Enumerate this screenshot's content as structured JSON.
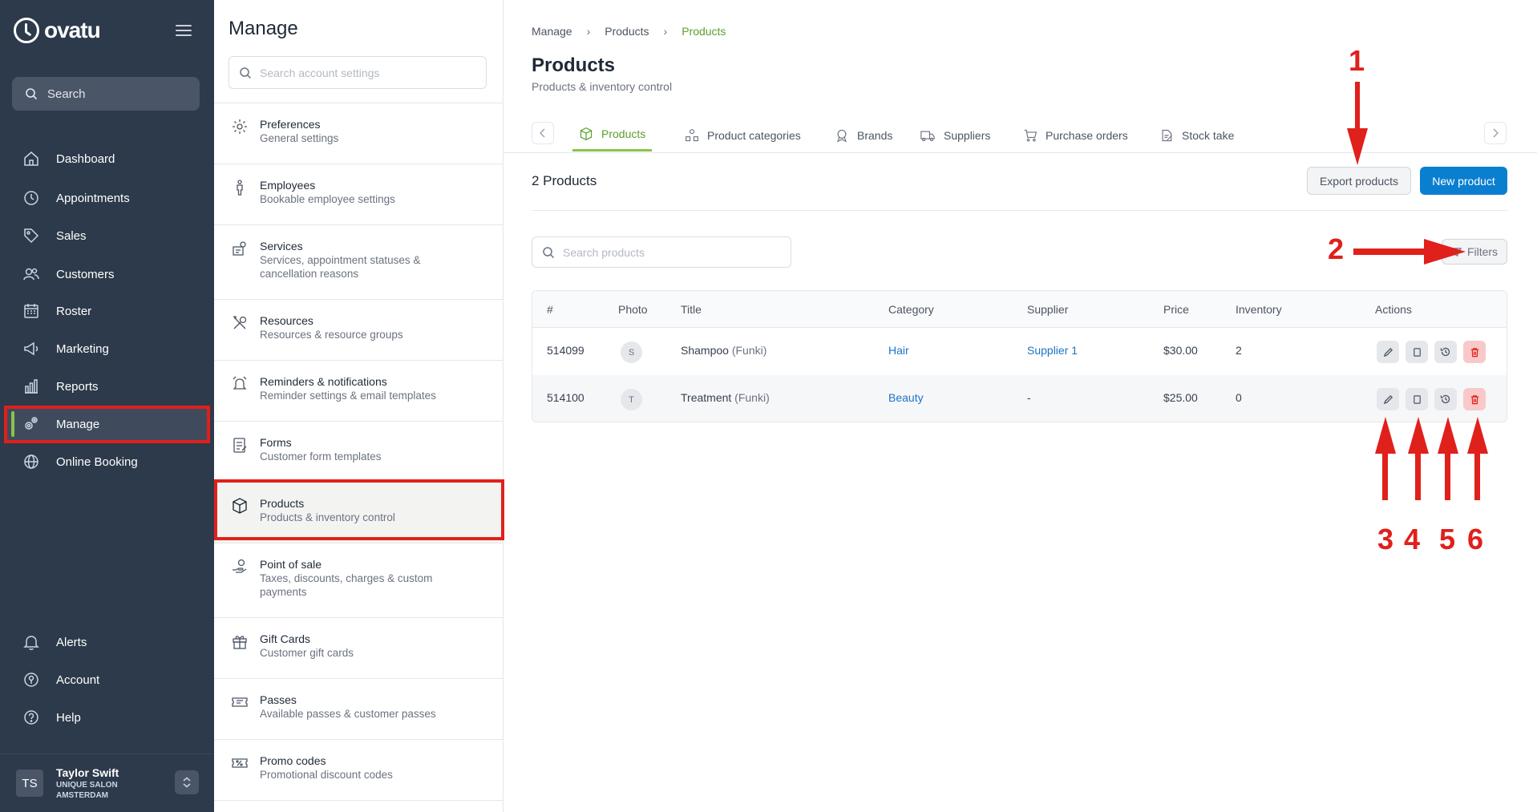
{
  "sidebar": {
    "brand": "ovatu",
    "search_label": "Search",
    "nav": [
      {
        "label": "Dashboard",
        "icon": "home-icon"
      },
      {
        "label": "Appointments",
        "icon": "clock-icon"
      },
      {
        "label": "Sales",
        "icon": "tag-icon"
      },
      {
        "label": "Customers",
        "icon": "users-icon"
      },
      {
        "label": "Roster",
        "icon": "calendar-icon"
      },
      {
        "label": "Marketing",
        "icon": "megaphone-icon"
      },
      {
        "label": "Reports",
        "icon": "bar-chart-icon"
      },
      {
        "label": "Manage",
        "icon": "gears-icon"
      },
      {
        "label": "Online Booking",
        "icon": "globe-icon"
      }
    ],
    "bottom_nav": [
      {
        "label": "Alerts",
        "icon": "bell-icon"
      },
      {
        "label": "Account",
        "icon": "account-icon"
      },
      {
        "label": "Help",
        "icon": "help-icon"
      }
    ],
    "user": {
      "initials": "TS",
      "name": "Taylor Swift",
      "line1": "UNIQUE SALON",
      "line2": "AMSTERDAM"
    }
  },
  "settings": {
    "title": "Manage",
    "search_placeholder": "Search account settings",
    "items": [
      {
        "title": "Preferences",
        "desc": "General settings"
      },
      {
        "title": "Employees",
        "desc": "Bookable employee settings"
      },
      {
        "title": "Services",
        "desc": "Services, appointment statuses & cancellation reasons"
      },
      {
        "title": "Resources",
        "desc": "Resources & resource groups"
      },
      {
        "title": "Reminders & notifications",
        "desc": "Reminder settings & email templates"
      },
      {
        "title": "Forms",
        "desc": "Customer form templates"
      },
      {
        "title": "Products",
        "desc": "Products & inventory control"
      },
      {
        "title": "Point of sale",
        "desc": "Taxes, discounts, charges & custom payments"
      },
      {
        "title": "Gift Cards",
        "desc": "Customer gift cards"
      },
      {
        "title": "Passes",
        "desc": "Available passes & customer passes"
      },
      {
        "title": "Promo codes",
        "desc": "Promotional discount codes"
      }
    ]
  },
  "main": {
    "breadcrumb": [
      "Manage",
      "Products",
      "Products"
    ],
    "title": "Products",
    "subtitle": "Products & inventory control",
    "tabs": [
      {
        "label": "Products",
        "icon": "box-icon"
      },
      {
        "label": "Product categories",
        "icon": "category-icon"
      },
      {
        "label": "Brands",
        "icon": "badge-icon"
      },
      {
        "label": "Suppliers",
        "icon": "truck-icon"
      },
      {
        "label": "Purchase orders",
        "icon": "cart-icon"
      },
      {
        "label": "Stock take",
        "icon": "clipboard-icon"
      }
    ],
    "count_title": "2 Products",
    "export_label": "Export products",
    "new_label": "New product",
    "search_placeholder": "Search products",
    "filters_label": "Filters",
    "table": {
      "headers": [
        "#",
        "Photo",
        "Title",
        "Category",
        "Supplier",
        "Price",
        "Inventory",
        "Actions"
      ],
      "rows": [
        {
          "id": "514099",
          "photo": "S",
          "title": "Shampoo",
          "brand": "(Funki)",
          "category": "Hair",
          "supplier": "Supplier 1",
          "price": "$30.00",
          "inventory": "2"
        },
        {
          "id": "514100",
          "photo": "T",
          "title": "Treatment",
          "brand": "(Funki)",
          "category": "Beauty",
          "supplier": "-",
          "price": "$25.00",
          "inventory": "0"
        }
      ]
    }
  },
  "annotations": {
    "n1": "1",
    "n2": "2",
    "n3": "3",
    "n4": "4",
    "n5": "5",
    "n6": "6"
  },
  "colors": {
    "sidebar_bg": "#2d3a4b",
    "accent_green": "#8bc34a",
    "primary_blue": "#0b7fcf",
    "annotation_red": "#e0201b"
  }
}
